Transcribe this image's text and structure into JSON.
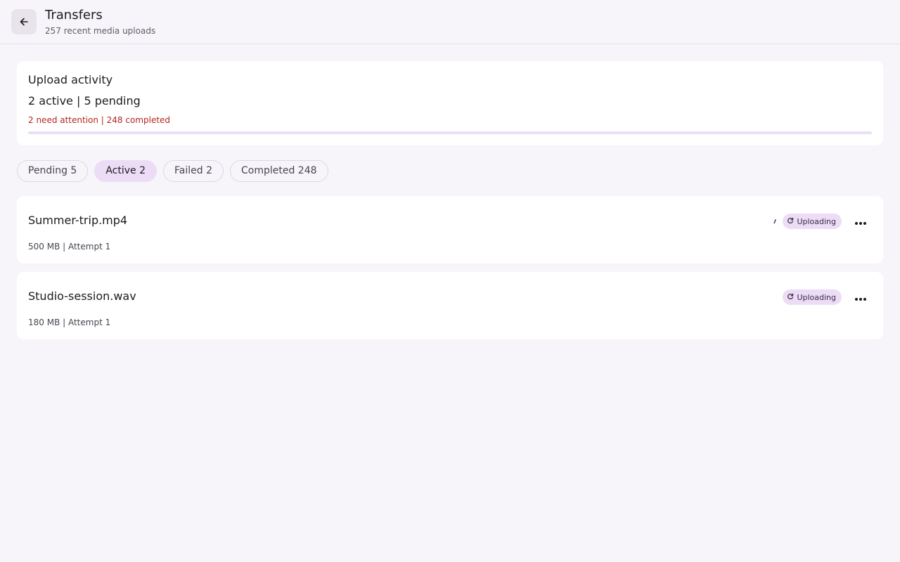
{
  "header": {
    "title": "Transfers",
    "subtitle": "257 recent media uploads"
  },
  "summary": {
    "heading": "Upload activity",
    "counts": "2 active | 5 pending",
    "alert": "2 need attention | 248 completed",
    "progress": 0,
    "alert_color": "#b3261e"
  },
  "tabs": [
    {
      "label": "Pending 5",
      "active": false
    },
    {
      "label": "Active 2",
      "active": true
    },
    {
      "label": "Failed 2",
      "active": false
    },
    {
      "label": "Completed 248",
      "active": false
    }
  ],
  "items": [
    {
      "name": "Summer-trip.mp4",
      "meta": "500 MB | Attempt 1",
      "status": "Uploading",
      "status_icon": "refresh-icon",
      "menu_icon": "more-horizontal-icon"
    },
    {
      "name": "Studio-session.wav",
      "meta": "180 MB | Attempt 1",
      "status": "Uploading",
      "status_icon": "refresh-icon",
      "menu_icon": "more-horizontal-icon"
    }
  ],
  "colors": {
    "accent": "#eddcf6",
    "background": "#f7f5fa",
    "card": "#ffffff"
  },
  "icons": {
    "back": "arrow-left-icon"
  }
}
